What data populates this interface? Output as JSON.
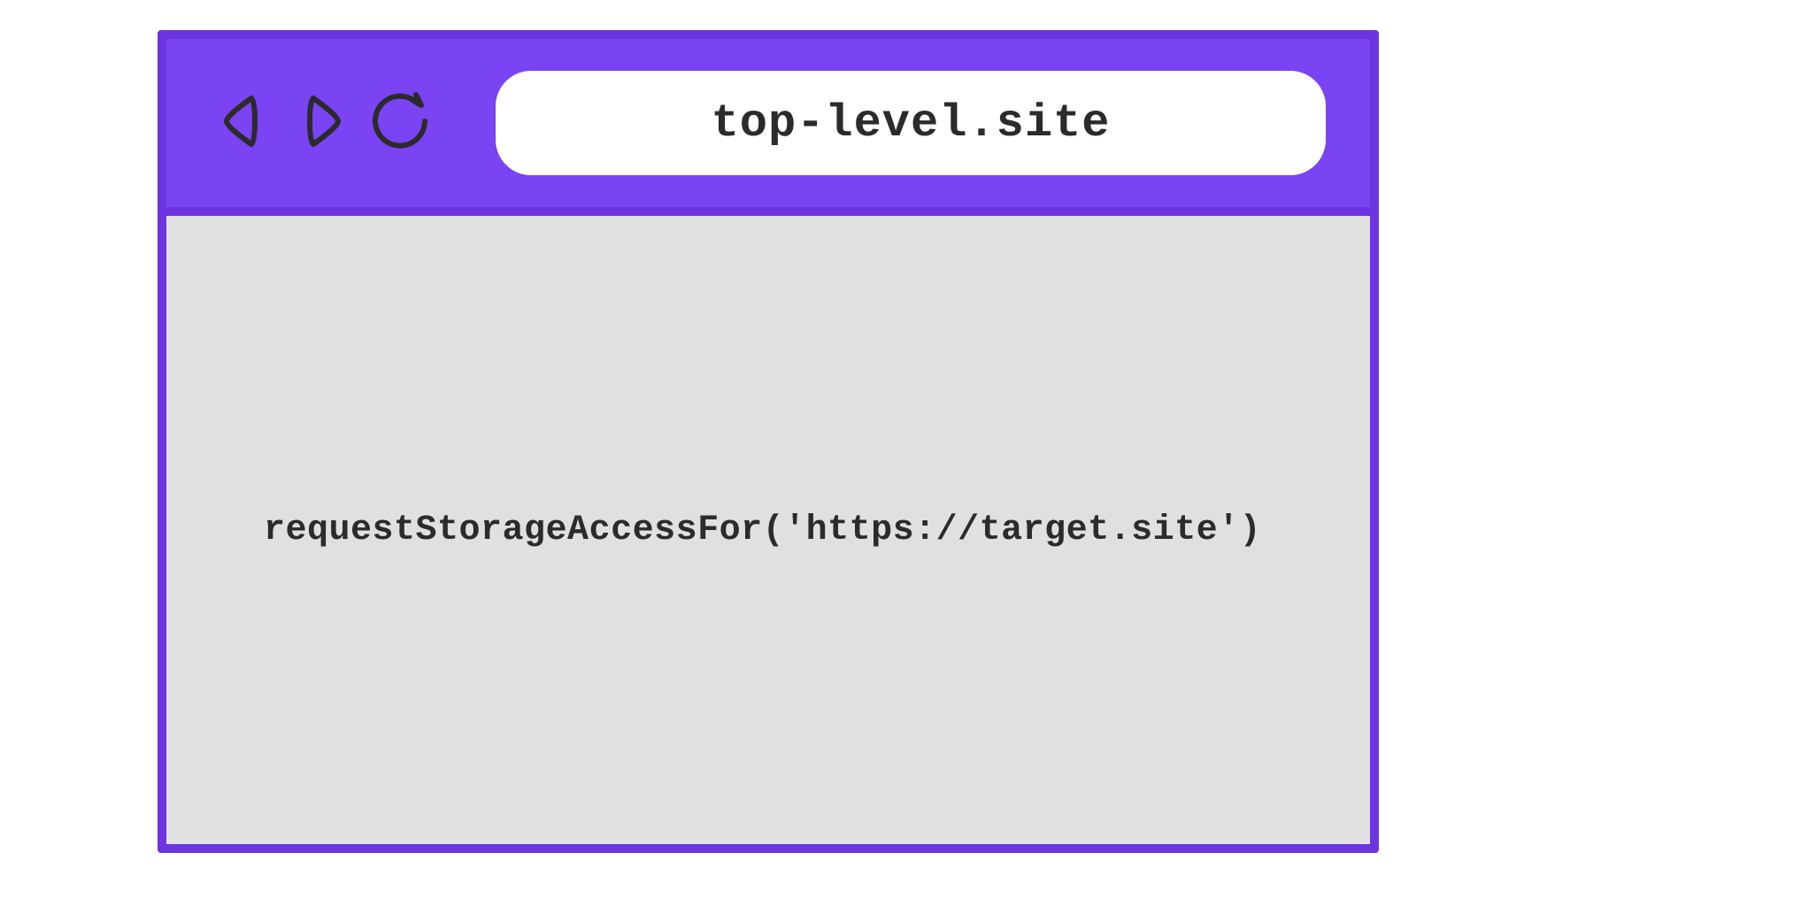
{
  "browser": {
    "address": "top-level.site",
    "content_code": "requestStorageAccessFor('https://target.site')"
  },
  "colors": {
    "toolbar_bg": "#7a43f3",
    "border": "#6c34e0",
    "content_bg": "#e0e0e0",
    "text": "#2b2b2b"
  }
}
